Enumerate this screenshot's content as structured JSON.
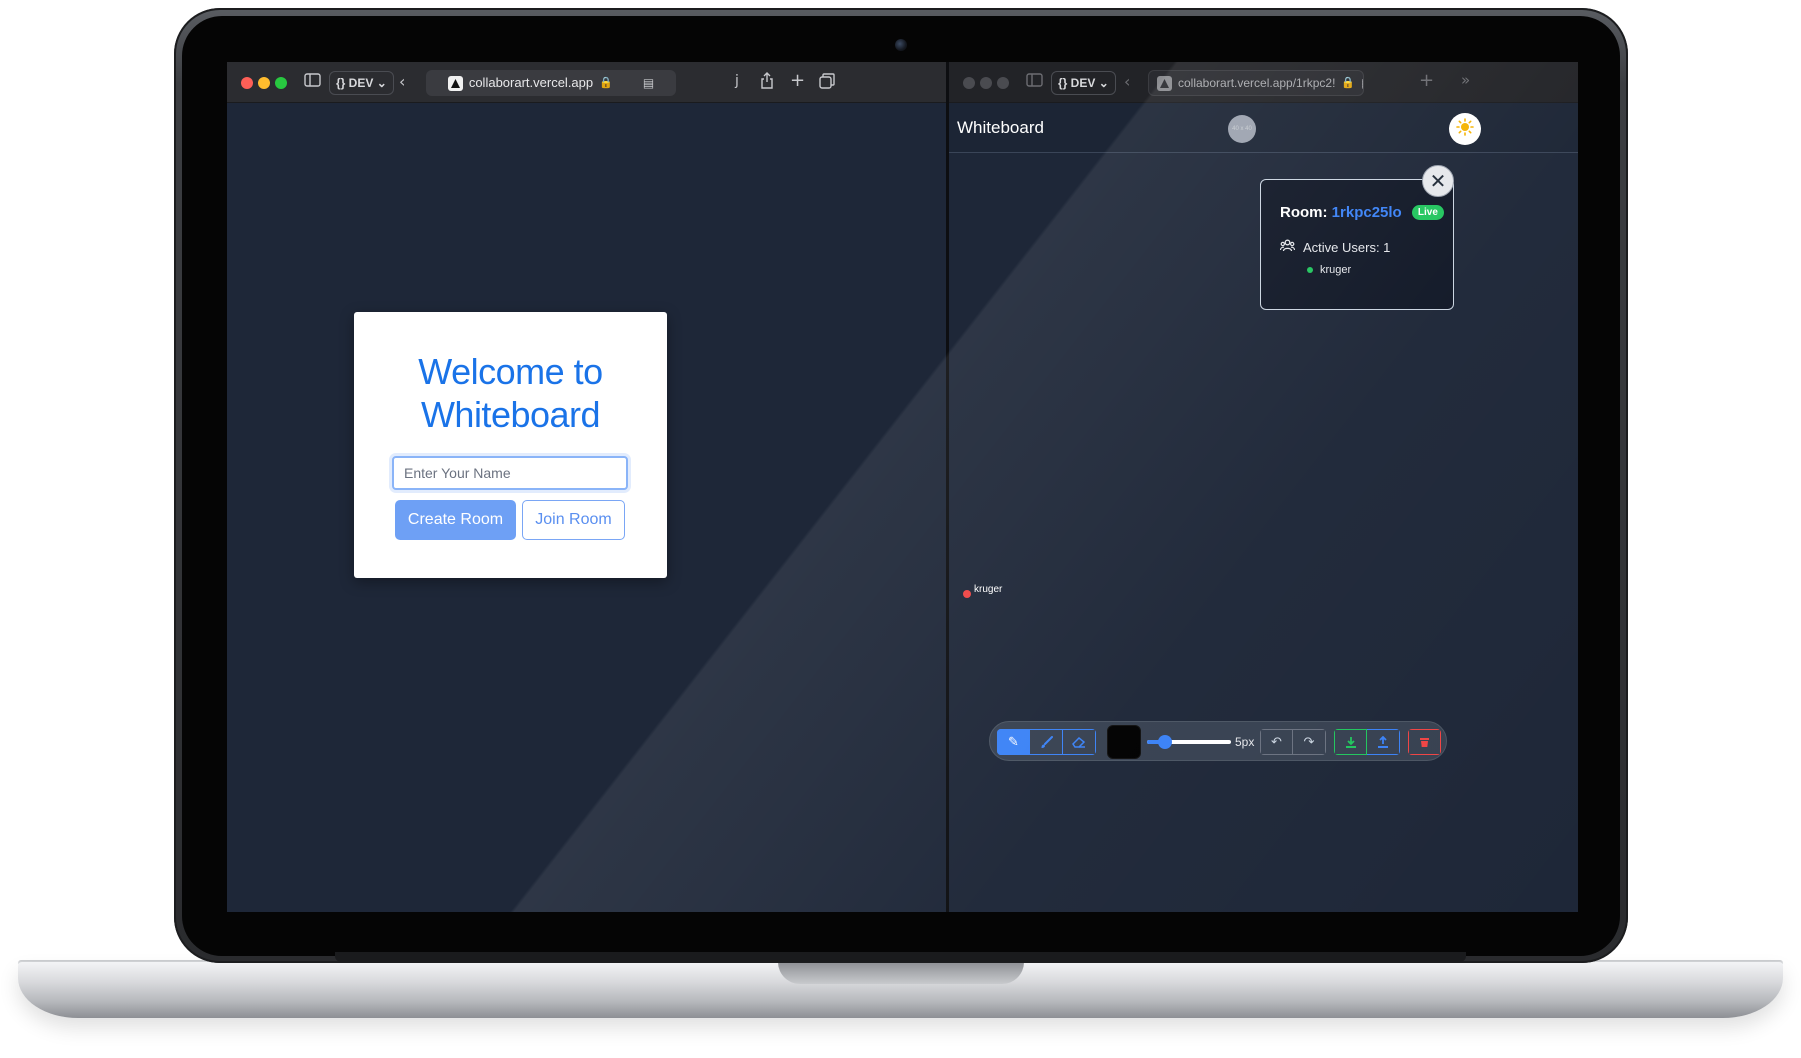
{
  "left_browser": {
    "dev_label": "{} DEV",
    "url": "collaborart.vercel.app",
    "toolbar_char": "j"
  },
  "welcome": {
    "title": "Welcome to Whiteboard",
    "name_placeholder": "Enter Your Name",
    "create_label": "Create Room",
    "join_label": "Join Room"
  },
  "right_browser": {
    "dev_label": "{} DEV",
    "url": "collaborart.vercel.app/1rkpc2!"
  },
  "whiteboard": {
    "title": "Whiteboard",
    "avatar_text": "40 x 40",
    "room_label": "Room:",
    "room_code": "1rkpc25lo",
    "live_badge": "Live",
    "active_users": "Active Users: 1",
    "users": [
      "kruger"
    ],
    "cursor_label": "kruger",
    "brush_size_label": "5px",
    "brush_size_fraction": 0.15,
    "stroke_color": "#000000"
  },
  "colors": {
    "accent": "#1a73e8",
    "live": "#22c55e",
    "danger": "#ef4444",
    "canvas_bg": "#1e2738"
  },
  "icons": [
    "sidebar-icon",
    "chevron-left-icon",
    "share-icon",
    "plus-icon",
    "tabs-icon",
    "reader-icon",
    "lock-icon",
    "sun-icon",
    "close-icon",
    "users-icon",
    "pencil-icon",
    "brush-icon",
    "eraser-icon",
    "undo-icon",
    "redo-icon",
    "download-icon",
    "upload-icon",
    "trash-icon",
    "double-chevron-right-icon"
  ]
}
